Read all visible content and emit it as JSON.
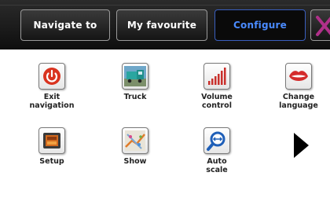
{
  "tabs": [
    {
      "label": "Navigate to",
      "active": false
    },
    {
      "label": "My favourite",
      "active": false
    },
    {
      "label": "Configure",
      "active": true
    }
  ],
  "colors": {
    "topbar_bg": "#1a1a1a",
    "active_tab_text": "#4a8bff",
    "active_tab_border": "#3a5fbf",
    "close_icon": "#b0308a",
    "content_bg": "#ffffff"
  },
  "menu": {
    "row1": [
      {
        "label": "Exit\nnavigation",
        "icon": "power-icon"
      },
      {
        "label": "Truck",
        "icon": "truck-icon"
      },
      {
        "label": "Volume\ncontrol",
        "icon": "volume-icon"
      },
      {
        "label": "Change\nlanguage",
        "icon": "lips-icon"
      }
    ],
    "row2": [
      {
        "label": "Setup",
        "icon": "setup-icon"
      },
      {
        "label": "Show",
        "icon": "map-show-icon"
      },
      {
        "label": "Auto\nscale",
        "icon": "magnifier-icon"
      }
    ]
  },
  "next_page": {
    "icon": "next-arrow-icon"
  }
}
